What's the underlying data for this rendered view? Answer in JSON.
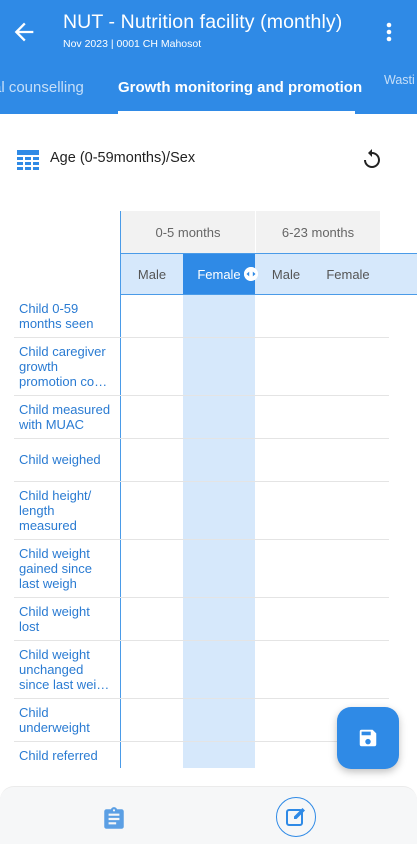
{
  "app_bar": {
    "title": "NUT - Nutrition facility (monthly)",
    "subtitle": "Nov 2023 | 0001 CH Mahosot",
    "back_icon": "arrow-left-icon",
    "menu_icon": "more-vertical-icon"
  },
  "tabs": [
    {
      "label": "al counselling",
      "active": false
    },
    {
      "label": "Growth monitoring and promotion",
      "active": true
    },
    {
      "label": "Wasti",
      "active": false
    }
  ],
  "section": {
    "icon": "table-icon",
    "label": "Age (0-59months)/Sex",
    "reset_icon": "refresh-icon"
  },
  "table": {
    "column_groups": [
      "0-5 months",
      "6-23 months"
    ],
    "sub_columns": [
      "Male",
      "Female",
      "Male",
      "Female"
    ],
    "selected_sub_column": "Female",
    "rows": [
      "Child 0-59\nmonths seen",
      "Child caregiver\ngrowth\npromotion co…",
      "Child measured\nwith MUAC",
      "Child weighed",
      "Child height/\nlength\nmeasured",
      "Child weight\ngained since\nlast weigh",
      "Child weight\nlost",
      "Child weight\nunchanged\nsince last wei…",
      "Child\nunderweight",
      "Child referred"
    ]
  },
  "fab": {
    "icon": "save-icon"
  },
  "bottom_nav": {
    "left_icon": "clipboard-icon",
    "right_icon": "edit-icon"
  },
  "colors": {
    "primary": "#2f8ae6",
    "highlight": "#d6e8fb",
    "label": "#2a7bd2"
  }
}
